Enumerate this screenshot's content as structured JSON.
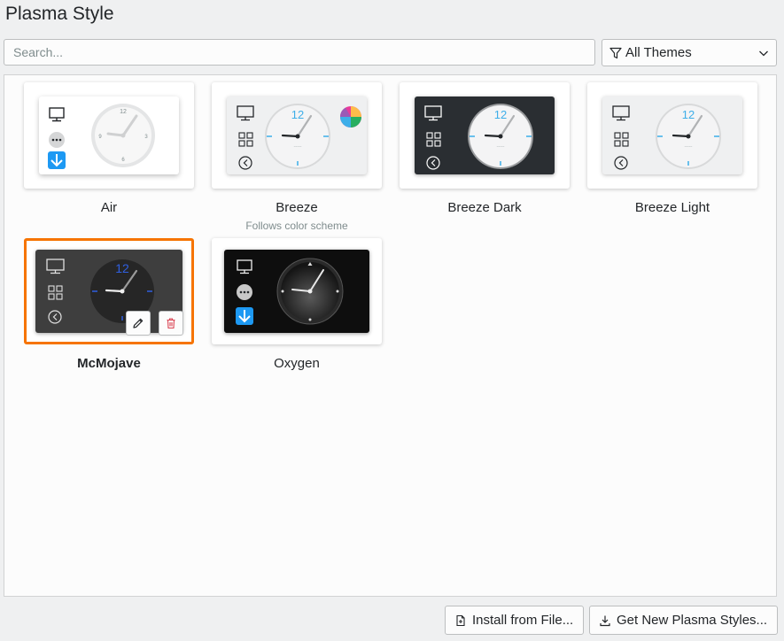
{
  "window": {
    "title": "Plasma Style"
  },
  "search": {
    "placeholder": "Search..."
  },
  "filter": {
    "label": "All Themes",
    "icon": "funnel-icon"
  },
  "themes": [
    {
      "name": "Air",
      "subtitle": ""
    },
    {
      "name": "Breeze",
      "subtitle": "Follows color scheme"
    },
    {
      "name": "Breeze Dark",
      "subtitle": ""
    },
    {
      "name": "Breeze Light",
      "subtitle": ""
    },
    {
      "name": "McMojave",
      "subtitle": "",
      "selected": true
    },
    {
      "name": "Oxygen",
      "subtitle": ""
    }
  ],
  "clock": {
    "twelve": "12"
  },
  "footer": {
    "install_label": "Install from File...",
    "get_new_label": "Get New Plasma Styles..."
  },
  "colors": {
    "accent": "#f67400",
    "link": "#3daee9",
    "delete": "#da4453"
  }
}
